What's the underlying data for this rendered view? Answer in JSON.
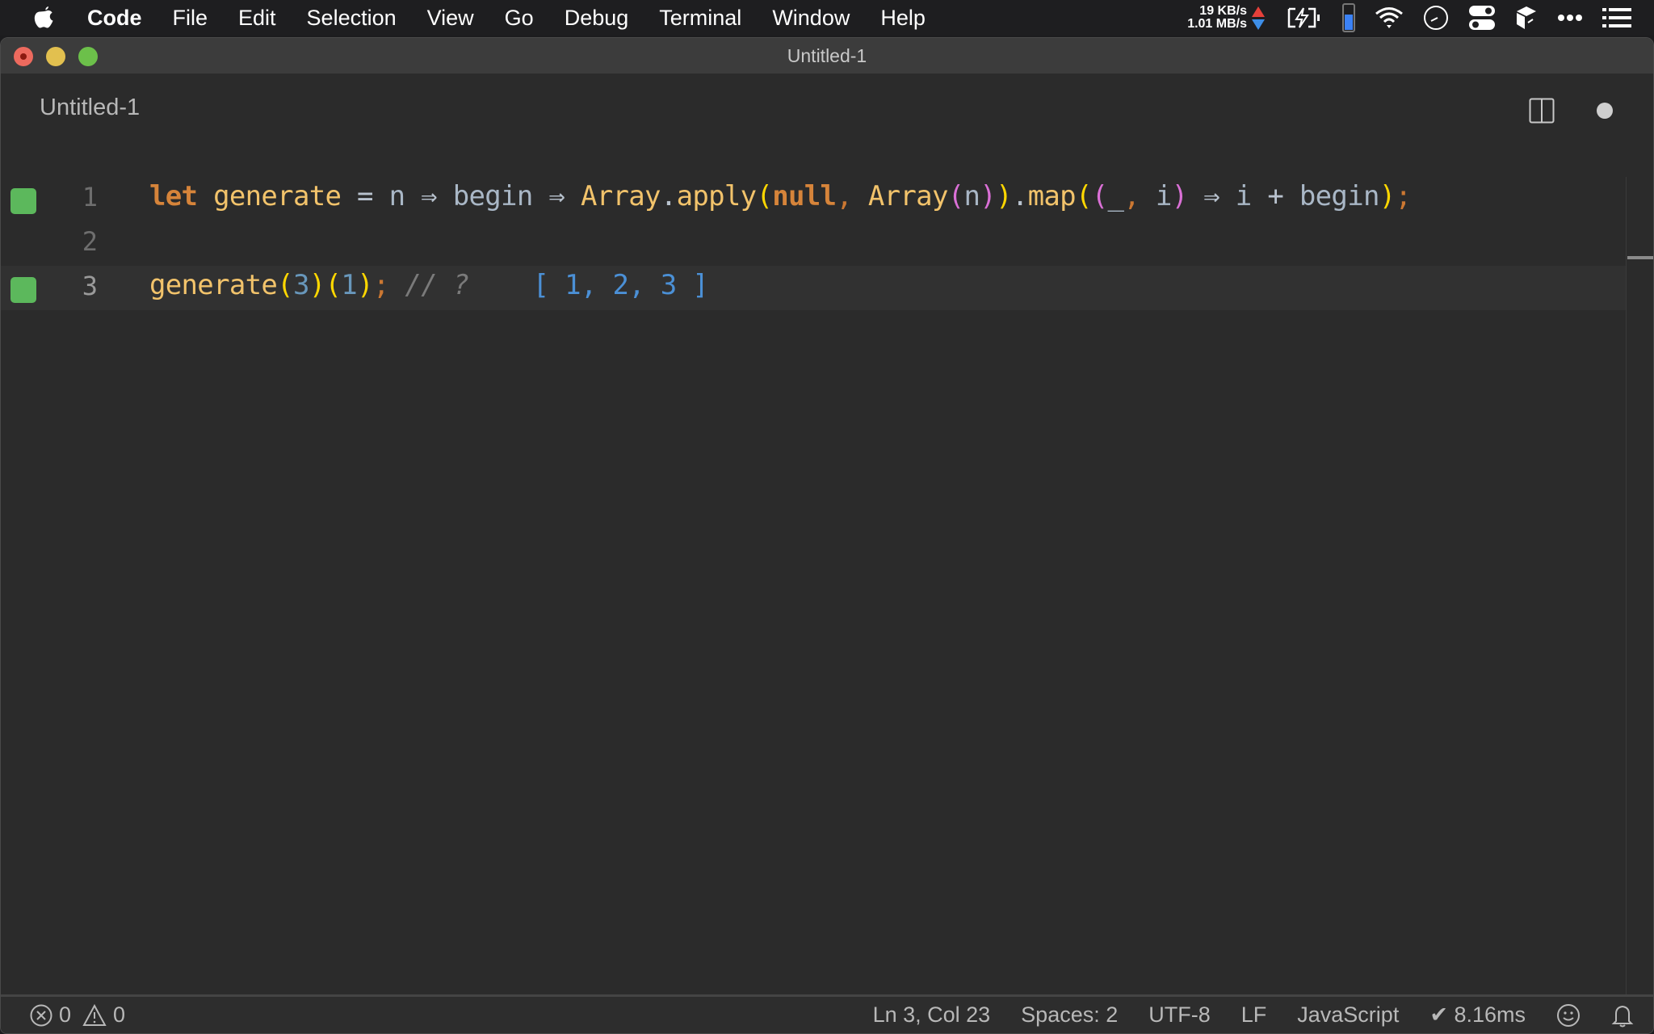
{
  "menubar": {
    "apple_icon": "apple-logo-icon",
    "items": [
      "Code",
      "File",
      "Edit",
      "Selection",
      "View",
      "Go",
      "Debug",
      "Terminal",
      "Window",
      "Help"
    ],
    "status": {
      "upload_speed": "19 KB/s",
      "download_speed": "1.01 MB/s",
      "icons": [
        "battery-charging-icon",
        "battery-level-icon",
        "wifi-icon",
        "clock-icon",
        "control-center-icon",
        "cube-icon",
        "more-icon",
        "list-icon"
      ],
      "battery_level_fraction": 0.6
    }
  },
  "window": {
    "title": "Untitled-1",
    "traffic_lights": [
      "close",
      "minimize",
      "maximize"
    ]
  },
  "tab": {
    "label": "Untitled-1",
    "split_icon": "split-editor-icon",
    "unsaved_indicator": "dirty-dot"
  },
  "editor": {
    "lines": [
      {
        "number": "1",
        "marker": true
      },
      {
        "number": "2",
        "marker": false
      },
      {
        "number": "3",
        "marker": true,
        "current": true
      }
    ],
    "tokens": {
      "l1": [
        "let",
        "generate",
        "=",
        "n",
        "⇒",
        "begin",
        "⇒",
        "Array",
        ".",
        "apply",
        "(",
        "null",
        ",",
        "Array",
        "(",
        "n",
        ")",
        ")",
        ".",
        "map",
        "(",
        "(",
        "_",
        ",",
        "i",
        ")",
        "⇒",
        "i",
        "+",
        "begin",
        ")",
        ";"
      ],
      "l3": [
        "generate",
        "(",
        "3",
        ")",
        "(",
        "1",
        ")",
        ";",
        "// ?",
        "[ 1, 2, 3 ]"
      ]
    },
    "marker_color": "#5cb85c"
  },
  "statusbar": {
    "errors": "0",
    "warnings": "0",
    "position": "Ln 3, Col 23",
    "indent": "Spaces: 2",
    "encoding": "UTF-8",
    "eol": "LF",
    "language": "JavaScript",
    "timing": "✔ 8.16ms"
  }
}
